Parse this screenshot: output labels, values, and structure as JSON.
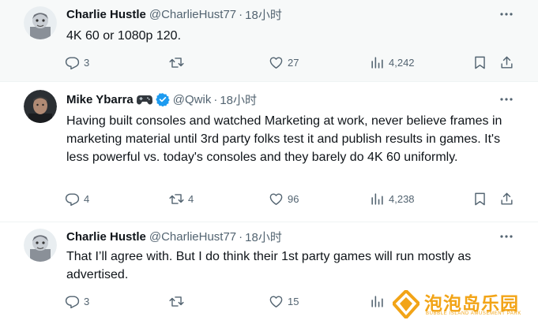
{
  "tweets": [
    {
      "author_name": "Charlie Hustle",
      "handle": "@CharlieHust77",
      "separator": "·",
      "time": "18小时",
      "text": "4K 60 or 1080p 120.",
      "replies": "3",
      "retweets": "",
      "likes": "27",
      "views": "4,242"
    },
    {
      "author_name": "Mike Ybarra",
      "handle": "@Qwik",
      "separator": "·",
      "time": "18小时",
      "text": "Having built consoles and watched Marketing at work, never believe frames in marketing material until 3rd party folks test it and publish results in games. It's less powerful vs. today's consoles and they barely do 4K 60 uniformly.",
      "replies": "4",
      "retweets": "4",
      "likes": "96",
      "views": "4,238"
    },
    {
      "author_name": "Charlie Hustle",
      "handle": "@CharlieHust77",
      "separator": "·",
      "time": "18小时",
      "text": "That I’ll agree with. But I do think their 1st party games will run mostly as advertised.",
      "replies": "3",
      "retweets": "",
      "likes": "15",
      "views": ""
    }
  ],
  "icons": {
    "reply": "reply-icon",
    "retweet": "retweet-icon",
    "like": "heart-icon",
    "views": "views-icon",
    "bookmark": "bookmark-icon",
    "share": "share-icon",
    "more": "more-icon",
    "verified": "verified-badge-icon",
    "controller": "gamepad-emoji-icon"
  },
  "colors": {
    "text": "#0f1419",
    "secondary": "#536471",
    "verified": "#1d9bf0",
    "watermark": "#f2a417",
    "highlight_bg": "#f7f9f9"
  },
  "watermark": {
    "title": "泡泡岛乐园",
    "subtitle": "BUBBLE ISLAND AMUSEMENT PARK"
  }
}
